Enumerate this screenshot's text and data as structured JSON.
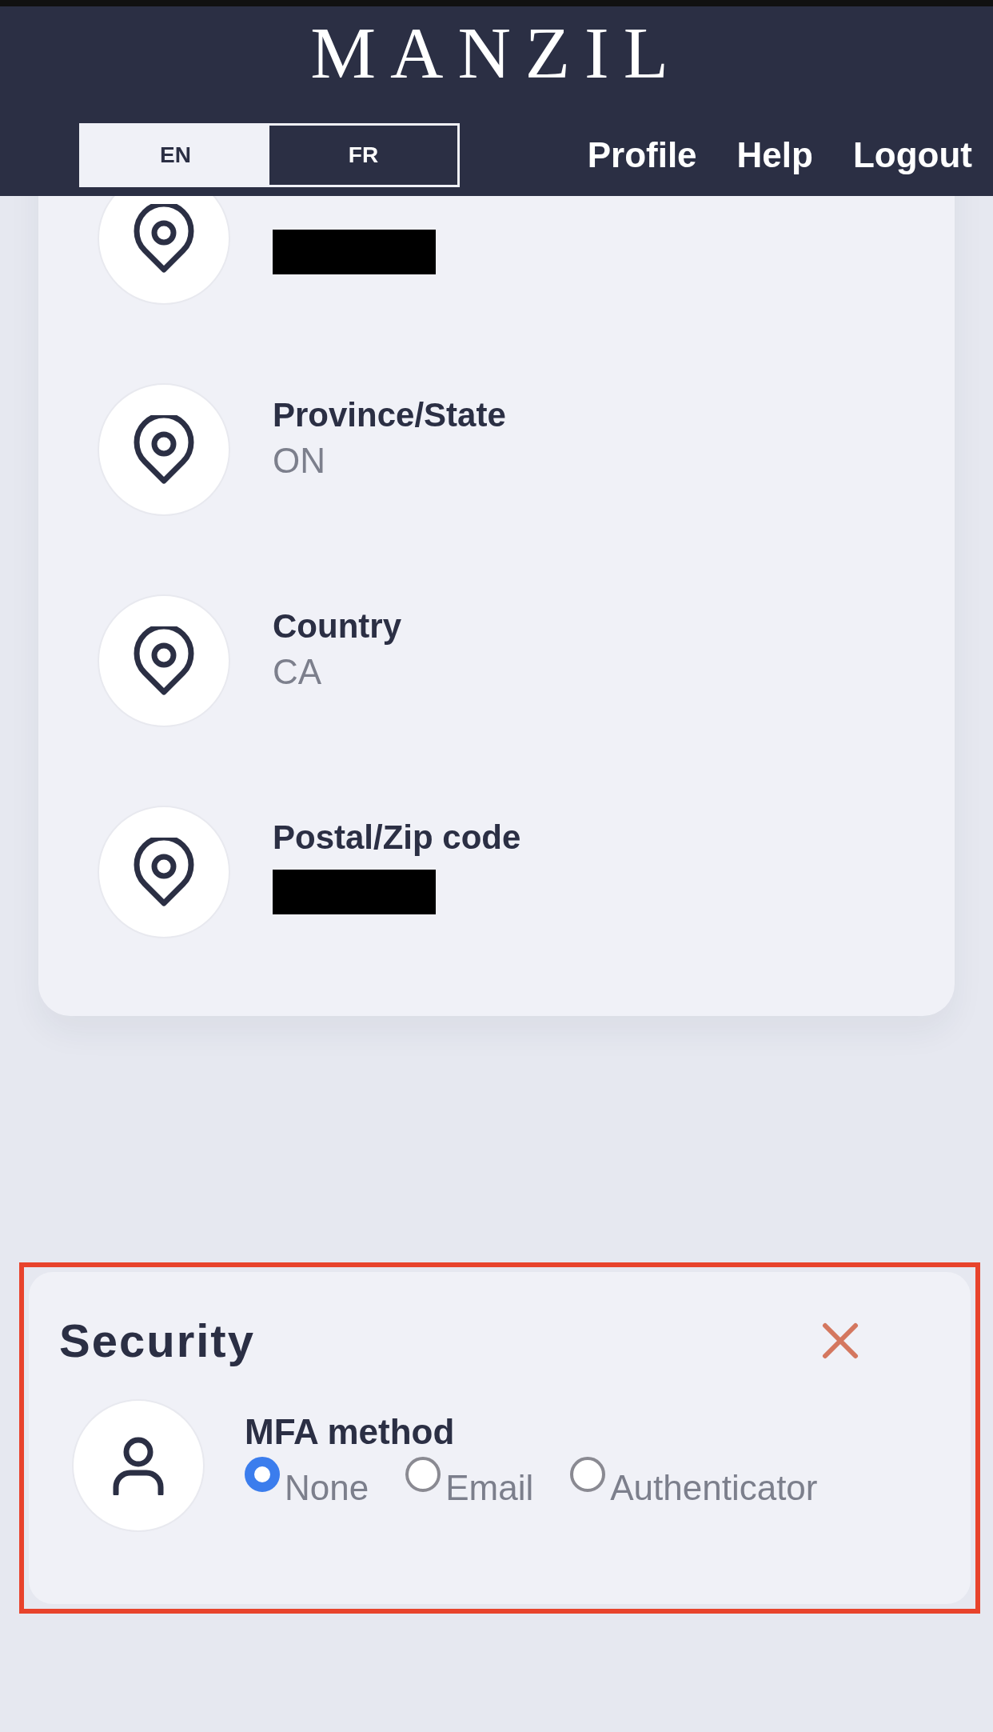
{
  "header": {
    "logo": "MANZIL",
    "languages": [
      {
        "label": "EN",
        "selected": true
      },
      {
        "label": "FR",
        "selected": false
      }
    ],
    "nav": [
      "Profile",
      "Help",
      "Logout"
    ]
  },
  "address_card": {
    "fields": [
      {
        "redacted": true
      },
      {
        "label": "Province/State",
        "value": "ON",
        "redacted": false
      },
      {
        "label": "Country",
        "value": "CA",
        "redacted": false
      },
      {
        "label": "Postal/Zip code",
        "redacted": true
      }
    ]
  },
  "security": {
    "title": "Security",
    "highlighted": true,
    "mfa": {
      "label": "MFA method",
      "options": [
        {
          "label": "None",
          "selected": true
        },
        {
          "label": "Email",
          "selected": false
        },
        {
          "label": "Authenticator",
          "selected": false
        }
      ]
    }
  }
}
